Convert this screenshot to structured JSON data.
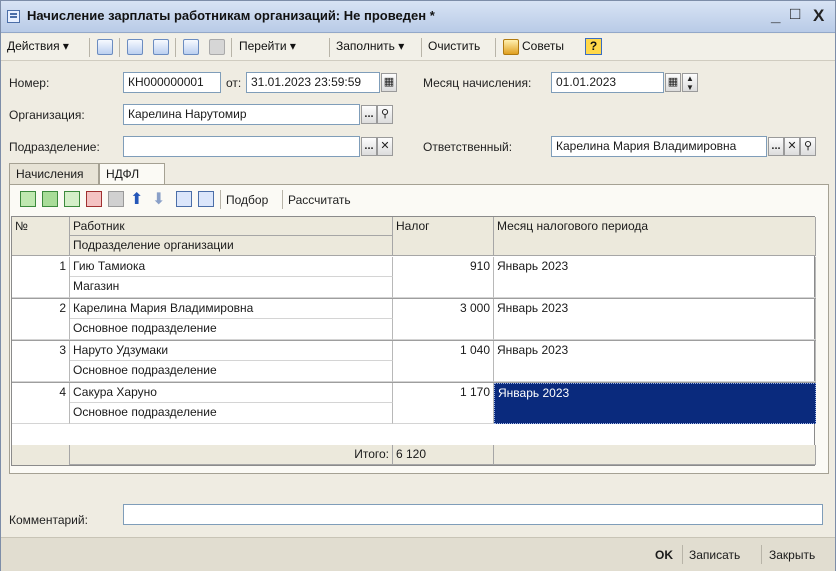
{
  "title": "Начисление зарплаты работникам организаций: Не проведен *",
  "window_controls": {
    "minimize": "_",
    "maximize": "□",
    "close": "X"
  },
  "toolbar": {
    "actions": "Действия ▾",
    "goto": "Перейти ▾",
    "fill": "Заполнить ▾",
    "clear": "Очистить",
    "tips": "Советы",
    "help": "?"
  },
  "form": {
    "number_label": "Номер:",
    "number_value": "КН000000001",
    "from_label": "от:",
    "date_value": "31.01.2023 23:59:59",
    "month_label": "Месяц начисления:",
    "month_value": "01.01.2023",
    "org_label": "Организация:",
    "org_value": "Карелина Нарутомир",
    "dept_label": "Подразделение:",
    "dept_value": "",
    "resp_label": "Ответственный:",
    "resp_value": "Карелина Мария Владимировна"
  },
  "tabs": [
    {
      "label": "Начисления"
    },
    {
      "label": "НДФЛ"
    }
  ],
  "grid_toolbar": {
    "pick": "Подбор",
    "calc": "Рассчитать"
  },
  "table": {
    "headers": {
      "num": "№",
      "worker": "Работник",
      "worker_sub": "Подразделение организации",
      "tax": "Налог",
      "period": "Месяц налогового периода"
    },
    "rows": [
      {
        "n": "1",
        "worker": "Гию Тамиока",
        "dept": "Магазин",
        "tax": "910",
        "period": "Январь 2023"
      },
      {
        "n": "2",
        "worker": "Карелина Мария Владимировна",
        "dept": "Основное подразделение",
        "tax": "3 000",
        "period": "Январь 2023"
      },
      {
        "n": "3",
        "worker": "Наруто Удзумаки",
        "dept": "Основное подразделение",
        "tax": "1 040",
        "period": "Январь 2023"
      },
      {
        "n": "4",
        "worker": "Сакура Харуно",
        "dept": "Основное подразделение",
        "tax": "1 170",
        "period": "Январь 2023"
      }
    ],
    "total_label": "Итого:",
    "total_value": "6 120"
  },
  "comment_label": "Комментарий:",
  "comment_value": "",
  "footer": {
    "ok": "OK",
    "save": "Записать",
    "close": "Закрыть"
  }
}
